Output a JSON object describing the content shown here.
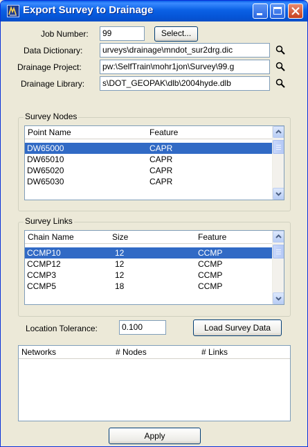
{
  "window": {
    "title": "Export Survey to Drainage"
  },
  "job": {
    "label": "Job Number:",
    "value": "99",
    "select_label": "Select..."
  },
  "data_dictionary": {
    "label": "Data Dictionary:",
    "value": "urveys\\drainage\\mndot_sur2drg.dic"
  },
  "drainage_project": {
    "label": "Drainage Project:",
    "value": "pw:\\SelfTrain\\mohr1jon\\Survey\\99.g"
  },
  "drainage_library": {
    "label": "Drainage Library:",
    "value": "s\\DOT_GEOPAK\\dlb\\2004hyde.dlb"
  },
  "survey_nodes": {
    "title": "Survey Nodes",
    "columns": [
      "Point Name",
      "Feature"
    ],
    "rows": [
      [
        "DW65000",
        "CAPR"
      ],
      [
        "DW65010",
        "CAPR"
      ],
      [
        "DW65020",
        "CAPR"
      ],
      [
        "DW65030",
        "CAPR"
      ]
    ],
    "selected_index": 0
  },
  "survey_links": {
    "title": "Survey Links",
    "columns": [
      "Chain Name",
      "Size",
      "Feature"
    ],
    "rows": [
      [
        "CCMP10",
        "12",
        "CCMP"
      ],
      [
        "CCMP12",
        "12",
        "CCMP"
      ],
      [
        "CCMP3",
        "12",
        "CCMP"
      ],
      [
        "CCMP5",
        "18",
        "CCMP"
      ]
    ],
    "selected_index": 0
  },
  "tolerance": {
    "label": "Location Tolerance:",
    "value": "0.100",
    "load_label": "Load Survey Data"
  },
  "networks": {
    "columns": [
      "Networks",
      "# Nodes",
      "# Links"
    ]
  },
  "apply_label": "Apply",
  "icons": {
    "app": "survey-drainage-icon",
    "browse": "magnifier-icon",
    "minimize": "minimize-icon",
    "maximize": "maximize-icon",
    "close": "close-icon"
  },
  "colors": {
    "titlebar": "#0554d6",
    "selection": "#316ac5",
    "dialog": "#ece9d8",
    "close": "#c6401e"
  }
}
